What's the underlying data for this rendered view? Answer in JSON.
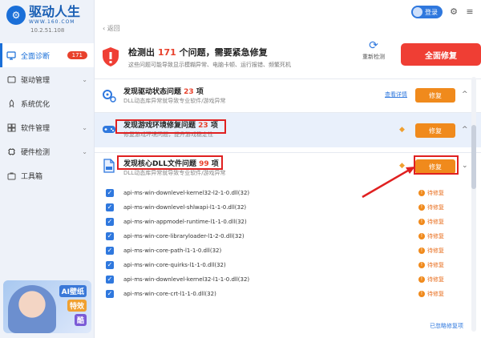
{
  "brand": {
    "name": "驱动人生",
    "site": "WWW.160.COM",
    "version": "10.2.51.108"
  },
  "topbar": {
    "login_label": "登录"
  },
  "nav": {
    "items": [
      {
        "label": "全面诊断",
        "badge": "171"
      },
      {
        "label": "驱动管理",
        "arrow": "⌄"
      },
      {
        "label": "系统优化"
      },
      {
        "label": "软件管理",
        "arrow": "⌄"
      },
      {
        "label": "硬件检测",
        "arrow": "⌄"
      },
      {
        "label": "工具箱"
      }
    ]
  },
  "avatar": {
    "tags": [
      "AI壁纸",
      "特效",
      "酷"
    ]
  },
  "back_label": "返回",
  "summary": {
    "title_prefix": "检测出",
    "count": "171",
    "title_suffix": "个问题，需要紧急修复",
    "subtitle": "这些问题可能导致显示模糊异常、电脑卡顿、运行报错、频繁死机",
    "rescan_label": "重新检测",
    "fix_all_label": "全面修复"
  },
  "sections": [
    {
      "title": "发现驱动状态问题",
      "count": "23",
      "unit": "项",
      "subtitle": "DLL动态库异常就导致专业软件/游戏异常",
      "detail_label": "查看详情",
      "fix_label": "修复",
      "chevron": "^"
    },
    {
      "title": "发现游戏环境修复问题",
      "count": "23",
      "unit": "项",
      "subtitle": "修复游戏环境问题，提升游戏稳定性",
      "fix_label": "修复",
      "chevron": "^"
    },
    {
      "title": "发现核心DLL文件问题",
      "count": "99",
      "unit": "项",
      "subtitle": "DLL动态库异常就导致专业软件/游戏异常",
      "fix_label": "修复",
      "chevron": "⌄"
    }
  ],
  "rows": [
    {
      "name": "api-ms-win-downlevel-kernel32-l2-1-0.dll(32)",
      "status": "待修复"
    },
    {
      "name": "api-ms-win-downlevel-shlwapi-l1-1-0.dll(32)",
      "status": "待修复"
    },
    {
      "name": "api-ms-win-appmodel-runtime-l1-1-0.dll(32)",
      "status": "待修复"
    },
    {
      "name": "api-ms-win-core-libraryloader-l1-2-0.dll(32)",
      "status": "待修复"
    },
    {
      "name": "api-ms-win-core-path-l1-1-0.dll(32)",
      "status": "待修复"
    },
    {
      "name": "api-ms-win-core-quirks-l1-1-0.dll(32)",
      "status": "待修复"
    },
    {
      "name": "api-ms-win-downlevel-kernel32-l1-1-0.dll(32)",
      "status": "待修复"
    },
    {
      "name": "api-ms-win-core-crt-l1-1-0.dll(32)",
      "status": "待修复"
    }
  ],
  "ignored_label": "已忽略修复项",
  "colors": {
    "accent": "#2f78de",
    "danger": "#ef3e34",
    "warn": "#f08a1c"
  }
}
